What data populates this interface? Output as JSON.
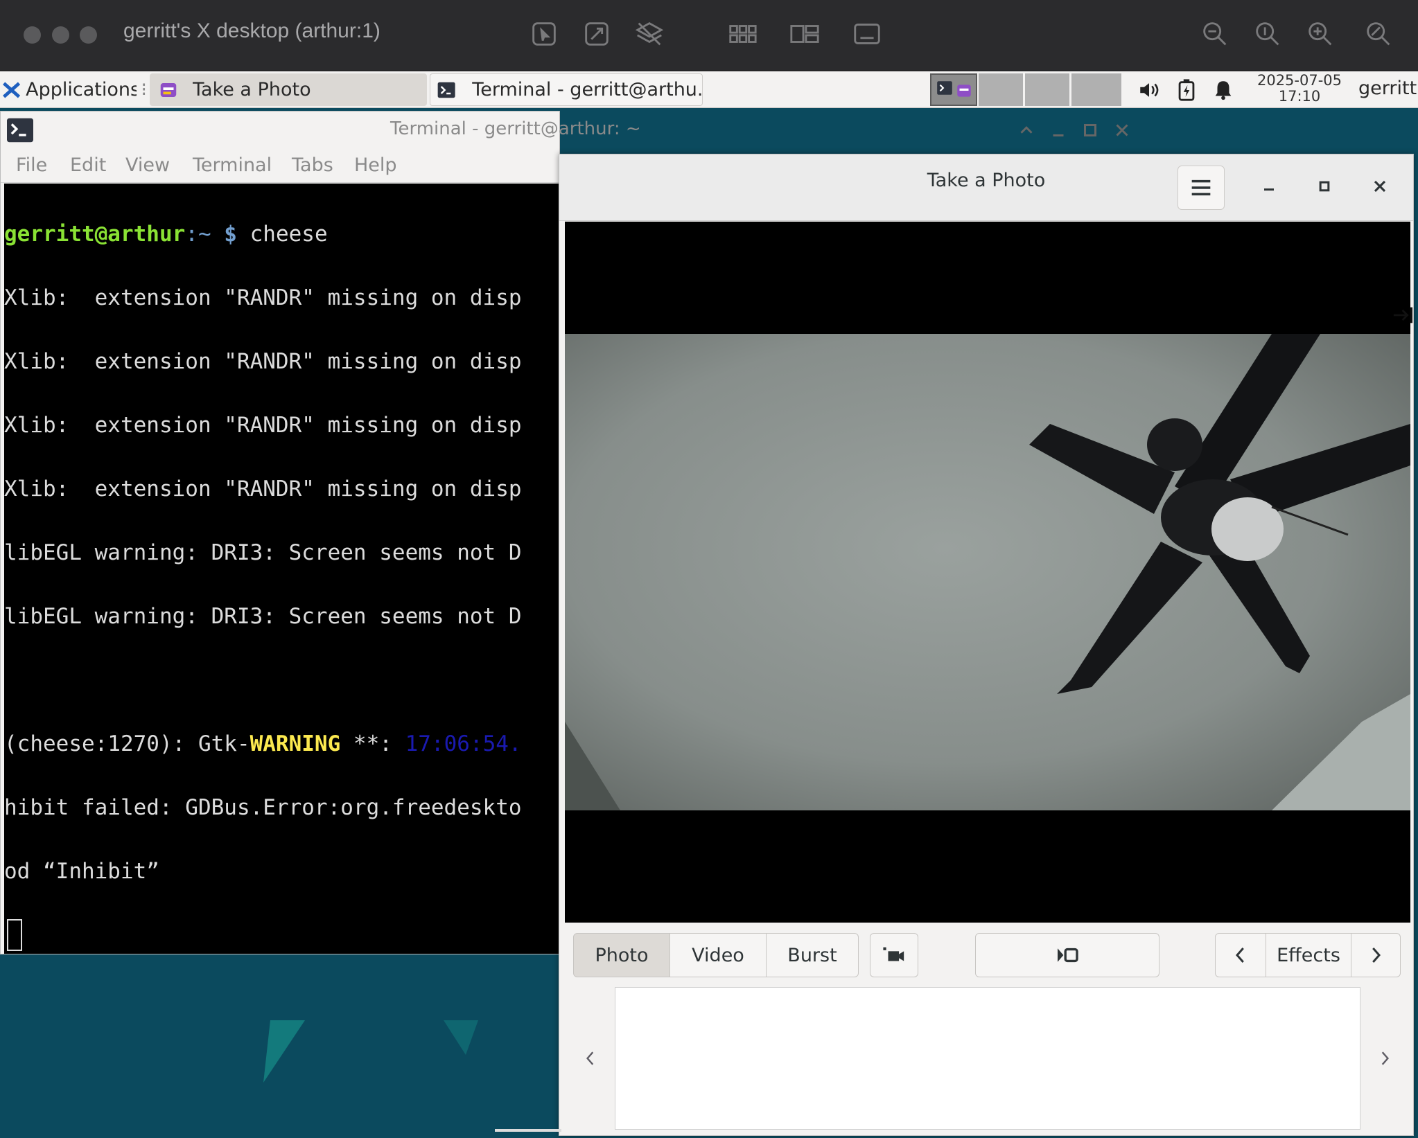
{
  "viewer": {
    "title": "gerritt's X desktop (arthur:1)",
    "icons": [
      "pointer-icon",
      "scale-icon",
      "layers-icon",
      "grid-icon",
      "split-icon",
      "display-icon",
      "zoom-out-icon",
      "zoom-fit-icon",
      "zoom-in-icon",
      "zoom-reset-icon"
    ]
  },
  "panel": {
    "applications": "Applications",
    "tasks": [
      {
        "label": "Take a Photo",
        "icon": "cheese-icon"
      },
      {
        "label": "Terminal - gerritt@arthu...",
        "icon": "terminal-icon"
      }
    ],
    "clock_date": "2025-07-05",
    "clock_time": "17:10",
    "user": "gerritt"
  },
  "terminal": {
    "title": "Terminal - gerritt@arthur: ~",
    "menu": [
      "File",
      "Edit",
      "View",
      "Terminal",
      "Tabs",
      "Help"
    ],
    "prompt_user": "gerritt@arthur",
    "prompt_path": ":~ ",
    "prompt_symbol": "$",
    "command": " cheese",
    "lines": [
      "Xlib:  extension \"RANDR\" missing on disp",
      "Xlib:  extension \"RANDR\" missing on disp",
      "Xlib:  extension \"RANDR\" missing on disp",
      "Xlib:  extension \"RANDR\" missing on disp",
      "libEGL warning: DRI3: Screen seems not D",
      "libEGL warning: DRI3: Screen seems not D"
    ],
    "warn_prefix": "(cheese:1270): Gtk-",
    "warn_word": "WARNING",
    "warn_mid": " **: ",
    "warn_time": "17:06:54.",
    "line_hibit": "hibit failed: GDBus.Error:org.freedeskto",
    "line_inhibit": "od “Inhibit”"
  },
  "cheese": {
    "title": "Take a Photo",
    "modes": [
      "Photo",
      "Video",
      "Burst"
    ],
    "active_mode": "Photo",
    "effects": "Effects"
  },
  "colors": {
    "desktop": "#0b4a5e",
    "prompt_green": "#8ae234",
    "prompt_blue": "#729fcf",
    "warning_yellow": "#fce94f",
    "timestamp_blue": "#1a1ab0"
  }
}
